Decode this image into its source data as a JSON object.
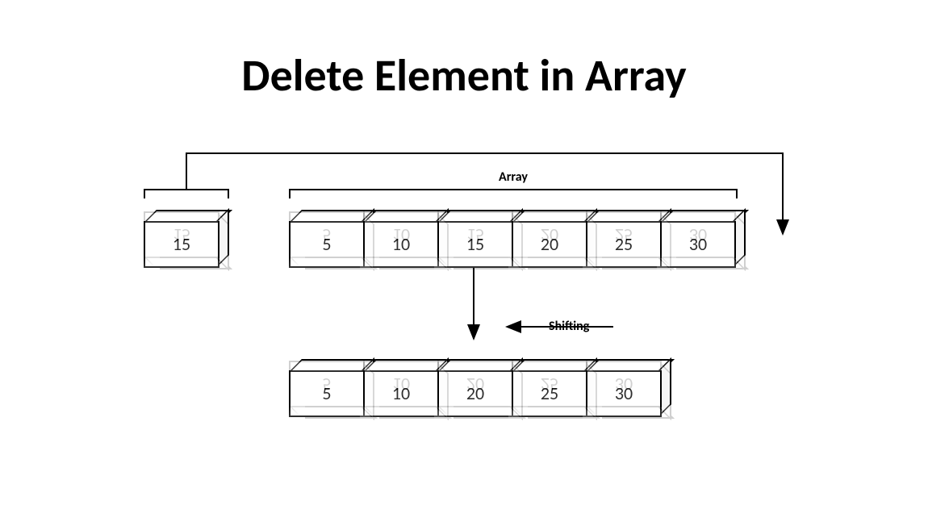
{
  "title": "Delete Element in Array",
  "labels": {
    "array": "Array",
    "shifting": "Shifting"
  },
  "element_to_delete": "15",
  "array_before": [
    "5",
    "10",
    "15",
    "20",
    "25",
    "30"
  ],
  "array_after": [
    "5",
    "10",
    "20",
    "25",
    "30"
  ]
}
